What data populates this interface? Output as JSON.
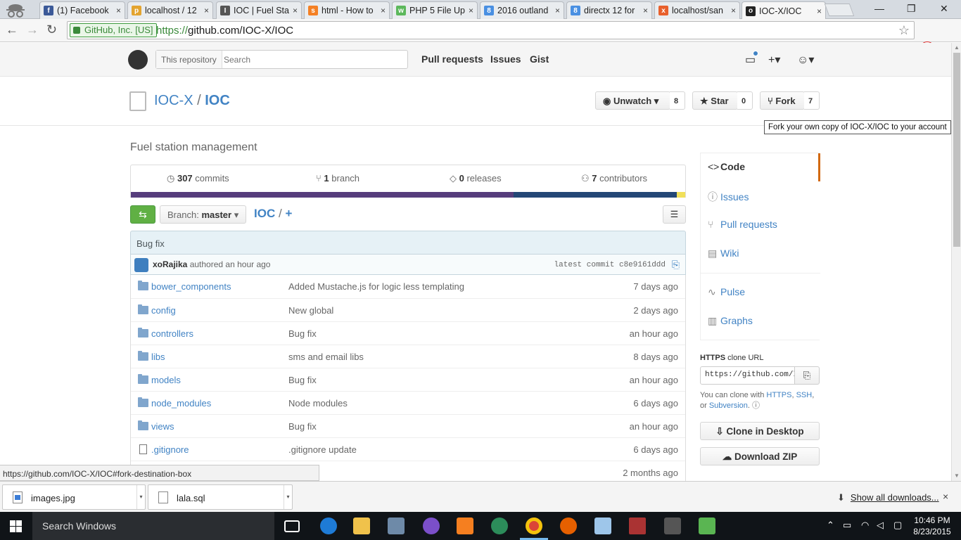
{
  "browser": {
    "tabs": [
      {
        "label": "(1) Facebook",
        "icon": "facebook-icon",
        "color": "#3b5998",
        "glyph": "f"
      },
      {
        "label": "localhost / 12",
        "icon": "phpmyadmin-icon",
        "color": "#e3a42f",
        "glyph": "p"
      },
      {
        "label": "IOC | Fuel Sta",
        "icon": "page-icon",
        "color": "#555555",
        "glyph": "I"
      },
      {
        "label": "html - How to",
        "icon": "stackoverflow-icon",
        "color": "#f48024",
        "glyph": "s"
      },
      {
        "label": "PHP 5 File Up",
        "icon": "w3schools-icon",
        "color": "#5cb85c",
        "glyph": "w"
      },
      {
        "label": "2016 outland",
        "icon": "google-icon",
        "color": "#4a90e2",
        "glyph": "8"
      },
      {
        "label": "directx 12 for",
        "icon": "google-icon",
        "color": "#4a90e2",
        "glyph": "8"
      },
      {
        "label": "localhost/san",
        "icon": "xampp-icon",
        "color": "#e8602c",
        "glyph": "x"
      },
      {
        "label": "IOC-X/IOC",
        "icon": "github-icon",
        "color": "#222222",
        "glyph": "o",
        "active": true
      }
    ],
    "close_glyph": "×",
    "window_controls": [
      "—",
      "❐",
      "✕"
    ],
    "nav": {
      "back": "←",
      "forward": "→",
      "reload": "↻",
      "star": "☆",
      "menu": "≡"
    },
    "ev_badge": "GitHub, Inc. [US]",
    "url_scheme": "https://",
    "url_rest": "github.com/IOC-X/IOC",
    "status_url": "https://github.com/IOC-X/IOC#fork-destination-box"
  },
  "github_header": {
    "search_scope": "This repository",
    "search_placeholder": "Search",
    "nav": [
      "Pull requests",
      "Issues",
      "Gist"
    ],
    "plus": "+▾",
    "user": "▾"
  },
  "repo": {
    "owner": "IOC-X",
    "separator": "/",
    "name": "IOC",
    "watch_label": "Unwatch",
    "watch_count": "8",
    "star_label": "Star",
    "star_count": "0",
    "fork_label": "Fork",
    "fork_count": "7",
    "fork_tooltip": "Fork your own copy of IOC-X/IOC to your account",
    "description": "Fuel station management"
  },
  "summary": {
    "commits_count": "307",
    "commits_label": "commits",
    "branch_count": "1",
    "branch_label": "branch",
    "releases_count": "0",
    "releases_label": "releases",
    "contributors_count": "7",
    "contributors_label": "contributors"
  },
  "language_bar": [
    {
      "color": "#563d7c",
      "fraction": 0.69
    },
    {
      "color": "#244776",
      "fraction": 0.295
    },
    {
      "color": "#f1e05a",
      "fraction": 0.015
    }
  ],
  "file_nav": {
    "branch_prefix": "Branch:",
    "branch_name": "master",
    "root": "IOC",
    "separator": "/",
    "add": "+"
  },
  "latest_commit": {
    "message": "Bug fix",
    "author": "xoRajika",
    "authored": "authored an hour ago",
    "latest_label": "latest commit",
    "sha": "c8e9161ddd"
  },
  "files": [
    {
      "type": "dir",
      "name": "bower_components",
      "message": "Added Mustache.js for logic less templating",
      "age": "7 days ago"
    },
    {
      "type": "dir",
      "name": "config",
      "message": "New global",
      "age": "2 days ago"
    },
    {
      "type": "dir",
      "name": "controllers",
      "message": "Bug fix",
      "age": "an hour ago"
    },
    {
      "type": "dir",
      "name": "libs",
      "message": "sms and email libs",
      "age": "8 days ago"
    },
    {
      "type": "dir",
      "name": "models",
      "message": "Bug fix",
      "age": "an hour ago"
    },
    {
      "type": "dir",
      "name": "node_modules",
      "message": "Node modules",
      "age": "6 days ago"
    },
    {
      "type": "dir",
      "name": "views",
      "message": "Bug fix",
      "age": "an hour ago"
    },
    {
      "type": "file",
      "name": ".gitignore",
      "message": ".gitignore update",
      "age": "6 days ago"
    },
    {
      "type": "file",
      "name": "",
      "message": "",
      "age": "2 months ago"
    }
  ],
  "sidebar": {
    "items": [
      {
        "label": "Code",
        "icon": "<>",
        "selected": true
      },
      {
        "label": "Issues",
        "icon": "ⓘ"
      },
      {
        "label": "Pull requests",
        "icon": "⑂"
      },
      {
        "label": "Wiki",
        "icon": "▤"
      },
      {
        "label": "Pulse",
        "icon": "∿"
      },
      {
        "label": "Graphs",
        "icon": "▥"
      }
    ],
    "clone_protocol": "HTTPS",
    "clone_label": "clone URL",
    "clone_url": "https://github.com/IOC-X/IOC.git",
    "clone_help_prefix": "You can clone with",
    "clone_help_https": "HTTPS",
    "clone_help_ssh": "SSH",
    "clone_help_or": ", or",
    "clone_help_svn": "Subversion",
    "clone_desktop": "Clone in Desktop",
    "download_zip": "Download ZIP"
  },
  "downloads": {
    "items": [
      {
        "name": "images.jpg",
        "icon": "image-file-icon"
      },
      {
        "name": "lala.sql",
        "icon": "file-icon"
      }
    ],
    "show_all": "Show all downloads...",
    "close": "×"
  },
  "taskbar": {
    "search": "Search Windows",
    "time": "10:46 PM",
    "date": "8/23/2015"
  }
}
